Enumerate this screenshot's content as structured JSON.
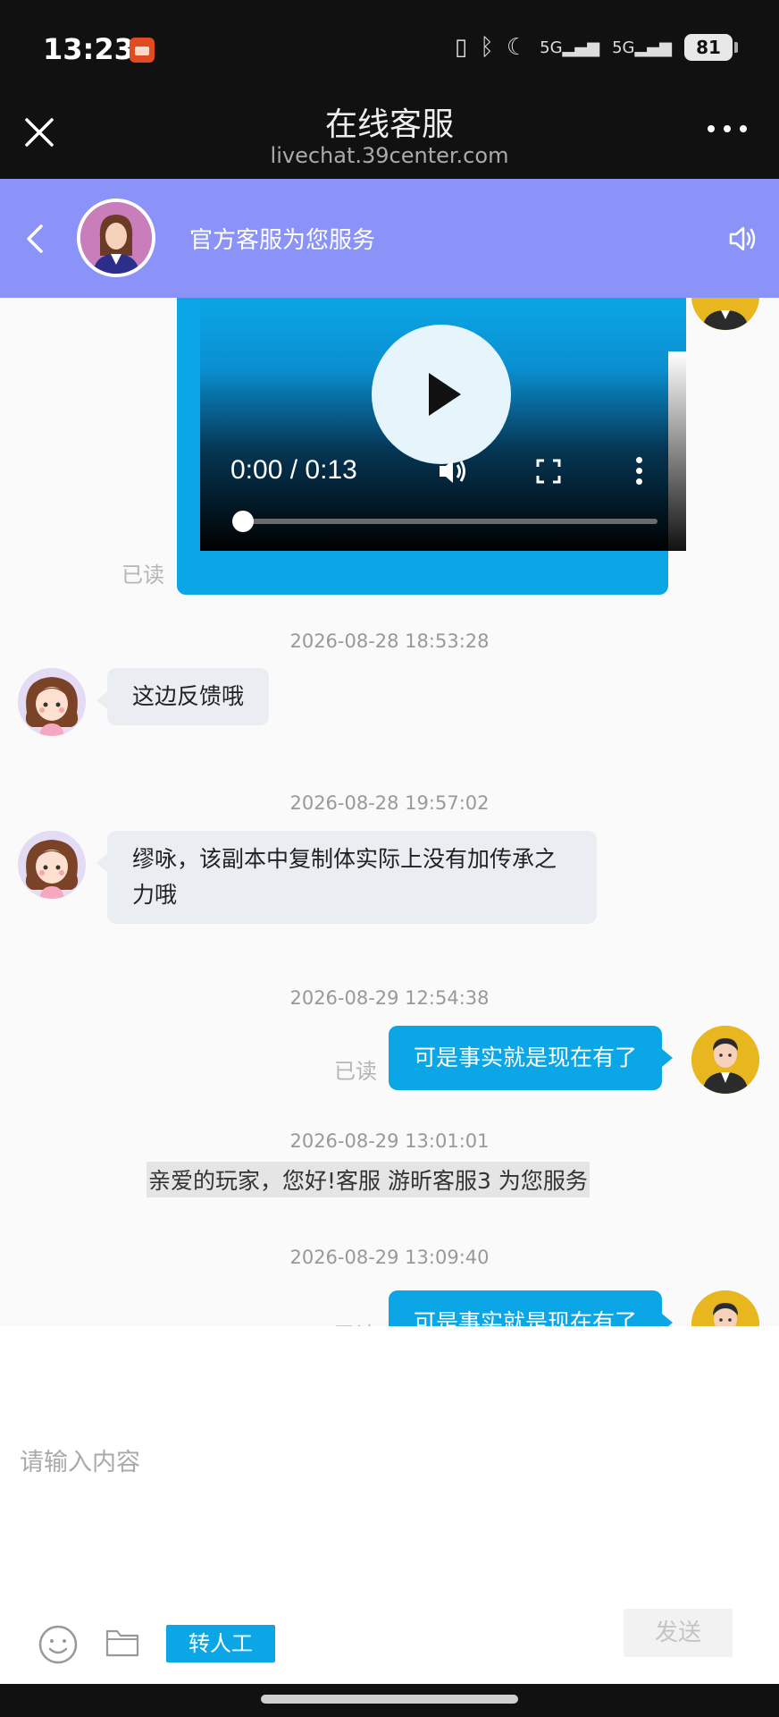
{
  "status_bar": {
    "time": "13:23",
    "network_1": "5G",
    "network_2": "5G",
    "battery": "81",
    "icons": [
      "vibrate-icon",
      "bluetooth-icon",
      "moon-icon",
      "signal-icon",
      "signal-icon",
      "battery-icon"
    ]
  },
  "app_header": {
    "title": "在线客服",
    "url": "livechat.39center.com"
  },
  "chat_header": {
    "subtitle": "官方客服为您服务"
  },
  "video_message": {
    "time_display": "0:00 / 0:13",
    "progress": 0,
    "read_label": "已读"
  },
  "messages": [
    {
      "timestamp": "2026-08-28 18:53:28",
      "sender": "agent",
      "text": "这边反馈哦"
    },
    {
      "timestamp": "2026-08-28 19:57:02",
      "sender": "agent",
      "text_line1": "缪咏，该副本中复制体实际上没有加传承之",
      "text_line2": "力哦"
    },
    {
      "timestamp": "2026-08-29 12:54:38",
      "sender": "user",
      "text": "可是事实就是现在有了",
      "read_label": "已读"
    },
    {
      "timestamp": "2026-08-29 13:01:01",
      "sender": "system",
      "text": "亲爱的玩家，您好!客服 游昕客服3 为您服务"
    },
    {
      "timestamp": "2026-08-29 13:09:40",
      "sender": "user",
      "text": "可是事实就是现在有了",
      "read_label": "已读"
    }
  ],
  "input": {
    "placeholder": "请输入内容",
    "value": "",
    "transfer_label": "转人工",
    "send_label": "发送"
  },
  "colors": {
    "header_purple": "#8b93f8",
    "bubble_blue": "#0ba6e6",
    "bubble_gray": "#eaedf1"
  }
}
